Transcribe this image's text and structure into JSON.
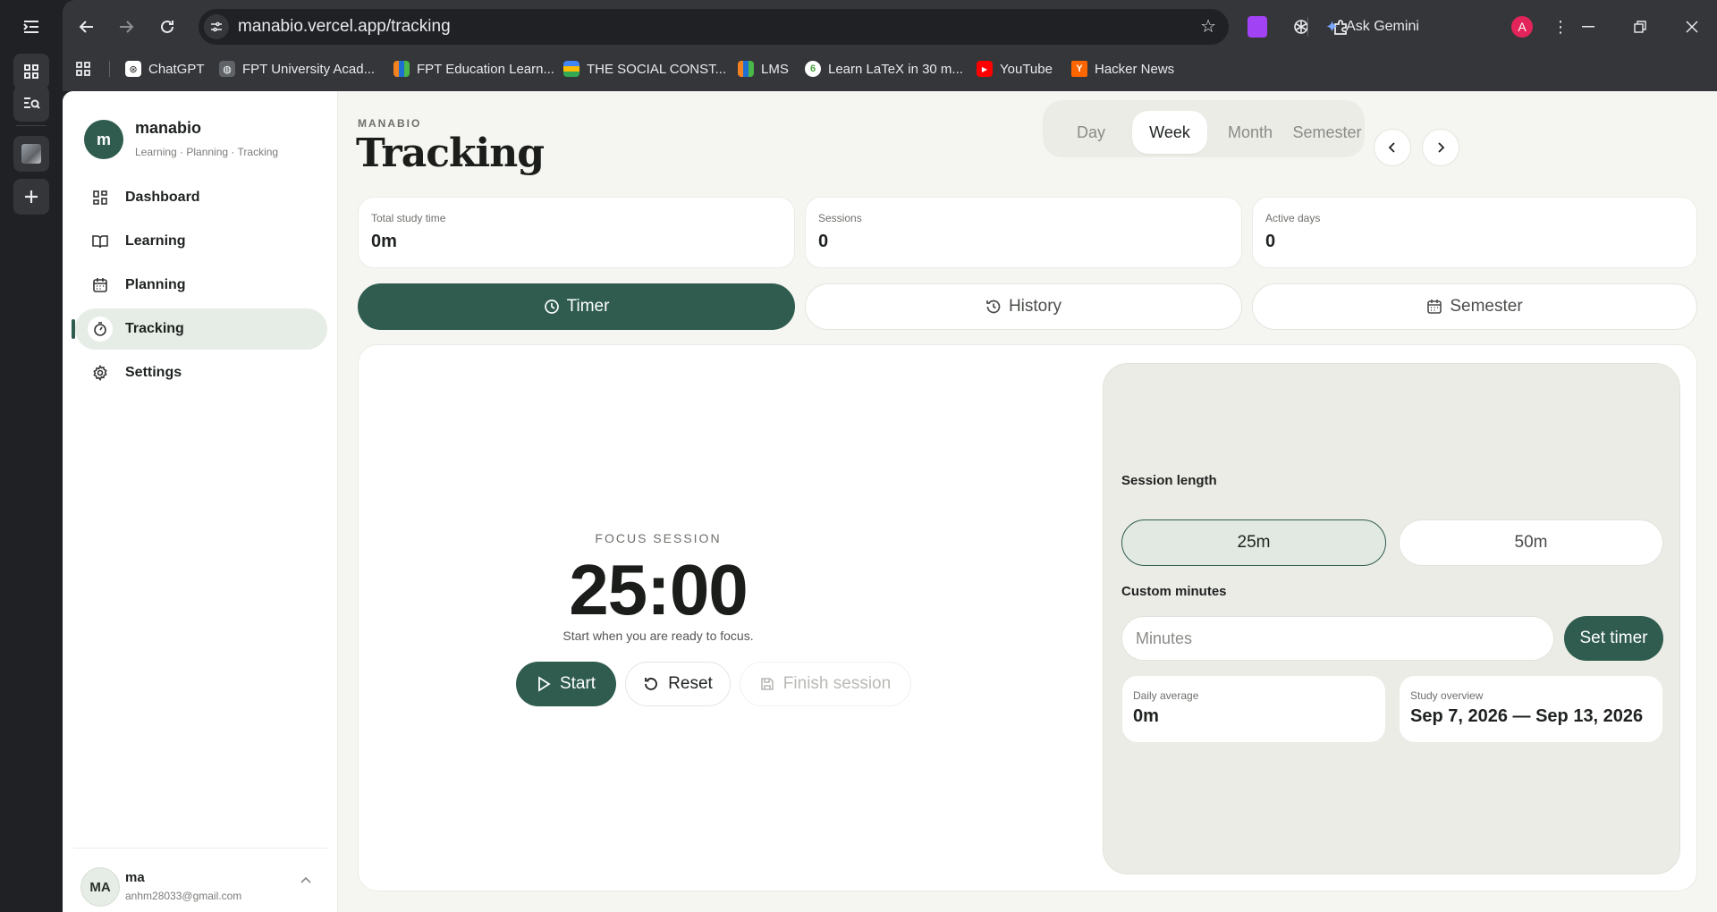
{
  "browser": {
    "url": "manabio.vercel.app/tracking",
    "ask_gemini": "Ask Gemini",
    "profile_initial": "A",
    "bookmarks": [
      {
        "label": "ChatGPT",
        "icon": "chatgpt-icon",
        "color": "#ffffff"
      },
      {
        "label": "FPT University Acad...",
        "icon": "globe-icon",
        "color": "#9aa0a6"
      },
      {
        "label": "FPT Education Learn...",
        "icon": "fpt-icon",
        "color": "#f58220"
      },
      {
        "label": "THE SOCIAL CONST...",
        "icon": "layers-icon",
        "color": "#4285f4"
      },
      {
        "label": "LMS",
        "icon": "fpt-icon",
        "color": "#f58220"
      },
      {
        "label": "Learn LaTeX in 30 m...",
        "icon": "overleaf-icon",
        "color": "#47a141"
      },
      {
        "label": "YouTube",
        "icon": "youtube-icon",
        "color": "#ff0000"
      },
      {
        "label": "Hacker News",
        "icon": "hackernews-icon",
        "color": "#ff6600"
      }
    ]
  },
  "brand": {
    "initial": "m",
    "name": "manabio",
    "tagline": "Learning · Planning · Tracking",
    "accent": "#2f5c4f"
  },
  "nav": [
    {
      "label": "Dashboard",
      "icon": "dashboard-icon"
    },
    {
      "label": "Learning",
      "icon": "book-icon"
    },
    {
      "label": "Planning",
      "icon": "calendar-icon"
    },
    {
      "label": "Tracking",
      "icon": "timer-icon",
      "active": true
    },
    {
      "label": "Settings",
      "icon": "gear-icon"
    }
  ],
  "user": {
    "initials": "MA",
    "name": "ma",
    "email": "anhm28033@gmail.com"
  },
  "page": {
    "eyebrow": "MANABIO",
    "title": "Tracking"
  },
  "range": {
    "options": [
      "Day",
      "Week",
      "Month",
      "Semester"
    ],
    "selected": "Week"
  },
  "stats": [
    {
      "label": "Total study time",
      "value": "0m"
    },
    {
      "label": "Sessions",
      "value": "0"
    },
    {
      "label": "Active days",
      "value": "0"
    }
  ],
  "tabs": [
    {
      "label": "Timer",
      "icon": "clock-icon",
      "active": true
    },
    {
      "label": "History",
      "icon": "history-icon"
    },
    {
      "label": "Semester",
      "icon": "calendar-icon"
    }
  ],
  "timer": {
    "label": "FOCUS SESSION",
    "time": "25:00",
    "subtitle": "Start when you are ready to focus.",
    "start": "Start",
    "reset": "Reset",
    "finish": "Finish session"
  },
  "session": {
    "heading": "Session length",
    "options": [
      "25m",
      "50m"
    ],
    "selected": "25m",
    "custom_heading": "Custom minutes",
    "custom_placeholder": "Minutes",
    "set_label": "Set timer"
  },
  "summary": {
    "daily_avg_label": "Daily average",
    "daily_avg_value": "0m",
    "overview_label": "Study overview",
    "overview_value": "Sep 7, 2026 — Sep 13, 2026"
  }
}
